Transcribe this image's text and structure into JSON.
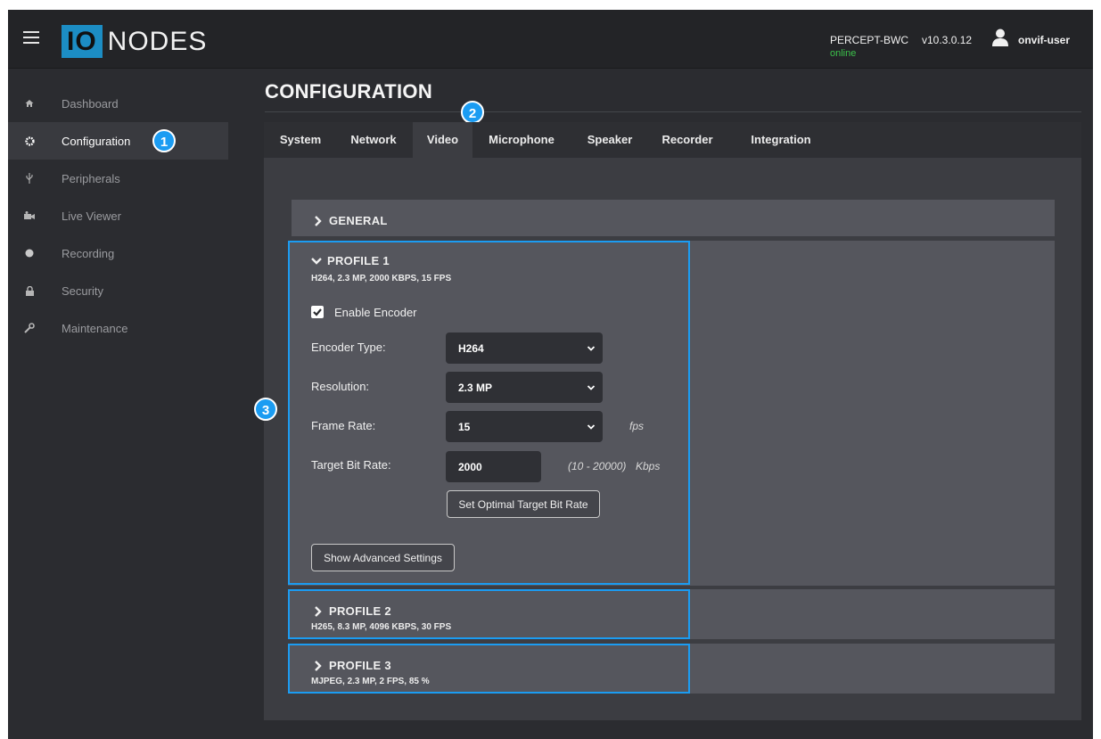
{
  "header": {
    "logo_mark": "IO",
    "logo_text": "NODES",
    "device_name": "PERCEPT-BWC",
    "device_status": "online",
    "version": "v10.3.0.12",
    "user": "onvif-user"
  },
  "sidebar": {
    "items": [
      {
        "label": "Dashboard",
        "icon": "home-icon"
      },
      {
        "label": "Configuration",
        "icon": "gear-icon"
      },
      {
        "label": "Peripherals",
        "icon": "usb-icon"
      },
      {
        "label": "Live Viewer",
        "icon": "camera-icon"
      },
      {
        "label": "Recording",
        "icon": "record-icon"
      },
      {
        "label": "Security",
        "icon": "lock-icon"
      },
      {
        "label": "Maintenance",
        "icon": "wrench-icon"
      }
    ]
  },
  "badges": {
    "b1": "1",
    "b2": "2",
    "b3": "3"
  },
  "page": {
    "title": "CONFIGURATION"
  },
  "tabs": [
    "System",
    "Network",
    "Video",
    "Microphone",
    "Speaker",
    "Recorder",
    "Integration"
  ],
  "general": {
    "title": "GENERAL"
  },
  "profile1": {
    "title": "PROFILE 1",
    "summary": "H264, 2.3 MP, 2000 KBPS, 15 FPS",
    "enable_encoder_label": "Enable Encoder",
    "enable_encoder_checked": true,
    "encoder_type_label": "Encoder Type:",
    "encoder_type_value": "H264",
    "resolution_label": "Resolution:",
    "resolution_value": "2.3 MP",
    "frame_rate_label": "Frame Rate:",
    "frame_rate_value": "15",
    "frame_rate_unit": "fps",
    "target_bit_rate_label": "Target Bit Rate:",
    "target_bit_rate_value": "2000",
    "target_bit_rate_range": "(10 - 20000)",
    "target_bit_rate_unit": "Kbps",
    "set_optimal_button": "Set Optimal Target Bit Rate",
    "advanced_button": "Show Advanced Settings"
  },
  "profile2": {
    "title": "PROFILE 2",
    "summary": "H265, 8.3 MP, 4096 KBPS, 30 FPS"
  },
  "profile3": {
    "title": "PROFILE 3",
    "summary": "MJPEG, 2.3 MP, 2 FPS, 85 %"
  },
  "colors": {
    "accent": "#1b9cf2",
    "online": "#3cc24b",
    "logo": "#1c8dc4"
  }
}
